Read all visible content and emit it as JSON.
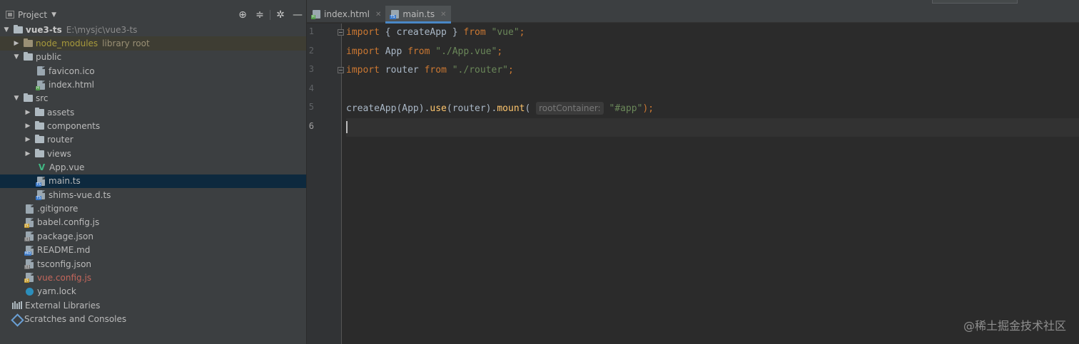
{
  "project_panel": {
    "title": "Project",
    "toolbar": {
      "locate_icon": "crosshair-icon",
      "collapse_icon": "collapse-all-icon",
      "settings_icon": "gear-icon",
      "hide_icon": "minimize-icon"
    },
    "tree": {
      "root": {
        "label": "vue3-ts",
        "path": "E:\\mysjc\\vue3-ts"
      },
      "node_modules": {
        "label": "node_modules",
        "note": "library root"
      },
      "public": "public",
      "favicon": "favicon.ico",
      "index_html": "index.html",
      "src": "src",
      "assets": "assets",
      "components": "components",
      "router": "router",
      "views": "views",
      "app_vue": "App.vue",
      "main_ts": "main.ts",
      "shims": "shims-vue.d.ts",
      "gitignore": ".gitignore",
      "babel": "babel.config.js",
      "package": "package.json",
      "readme": "README.md",
      "tsconfig": "tsconfig.json",
      "vue_config": "vue.config.js",
      "yarn": "yarn.lock",
      "external": "External Libraries",
      "scratches": "Scratches and Consoles"
    }
  },
  "editor": {
    "tabs": [
      {
        "label": "index.html",
        "icon": "html-file-icon",
        "active": false
      },
      {
        "label": "main.ts",
        "icon": "ts-file-icon",
        "active": true
      }
    ],
    "line_numbers": [
      "1",
      "2",
      "3",
      "4",
      "5",
      "6"
    ],
    "code": {
      "l1": {
        "kw1": "import",
        "t1": " { createApp } ",
        "kw2": "from",
        "t2": " ",
        "str": "\"vue\"",
        "t3": ";"
      },
      "l2": {
        "kw1": "import",
        "t1": " App ",
        "kw2": "from",
        "t2": " ",
        "str": "\"./App.vue\"",
        "t3": ";"
      },
      "l3": {
        "kw1": "import",
        "t1": " router ",
        "kw2": "from",
        "t2": " ",
        "str": "\"./router\"",
        "t3": ";"
      },
      "l5": {
        "t1": "createApp(App).",
        "fn1": "use",
        "t2": "(router).",
        "fn2": "mount",
        "t3": "( ",
        "hint": "rootContainer:",
        "t4": " ",
        "str": "\"#app\"",
        "t5": ");"
      }
    }
  },
  "watermark": "@稀土掘金技术社区",
  "colors": {
    "editor_bg": "#2b2b2b",
    "panel_bg": "#3c3f41",
    "selection": "#0d293e",
    "keyword": "#cc7832",
    "string": "#6a8759",
    "function": "#ffc66d",
    "accent": "#4a88c7"
  }
}
